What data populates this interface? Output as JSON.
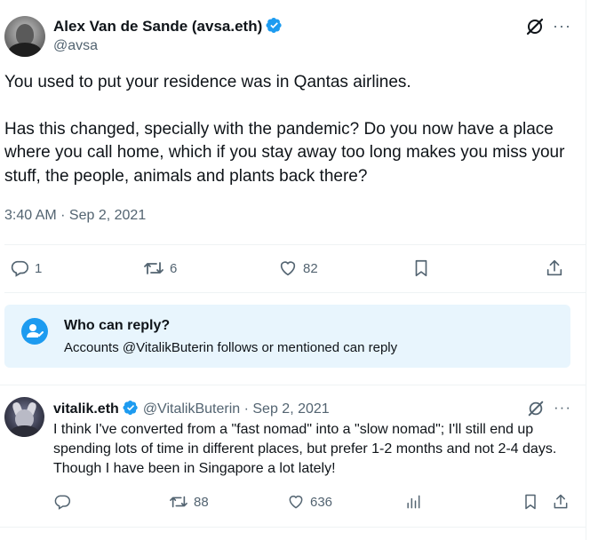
{
  "main_tweet": {
    "author_name": "Alex Van de Sande (avsa.eth)",
    "author_handle": "@avsa",
    "more_label": "···",
    "paragraphs": [
      "You used to put your residence was in Qantas airlines.",
      "Has this changed, specially with the pandemic? Do you now have a place where you call home, which if you stay away too long makes you miss your stuff, the people, animals and plants back there?"
    ],
    "timestamp": "3:40 AM · Sep 2, 2021",
    "actions": {
      "replies": "1",
      "retweets": "6",
      "likes": "82"
    }
  },
  "who_can_reply": {
    "title": "Who can reply?",
    "subtitle": "Accounts @VitalikButerin follows or mentioned can reply"
  },
  "reply_tweet": {
    "author_name": "vitalik.eth",
    "author_handle": "@VitalikButerin",
    "separator": "·",
    "date": "Sep 2, 2021",
    "more_label": "···",
    "text": "I think I've converted from a \"fast nomad\" into a \"slow nomad\"; I'll still end up spending lots of time in different places, but prefer 1-2 months and not 2-4 days. Though I have been in Singapore a lot lately!",
    "actions": {
      "retweets": "88",
      "likes": "636"
    }
  },
  "colors": {
    "verified": "#1d9bf0",
    "muted": "#536471",
    "reply_box_bg": "#e8f5fd"
  },
  "icons": [
    "verified-badge-icon",
    "grok-icon",
    "more-icon",
    "reply-icon",
    "retweet-icon",
    "like-icon",
    "bookmark-icon",
    "share-icon",
    "views-icon",
    "user-check-icon"
  ]
}
